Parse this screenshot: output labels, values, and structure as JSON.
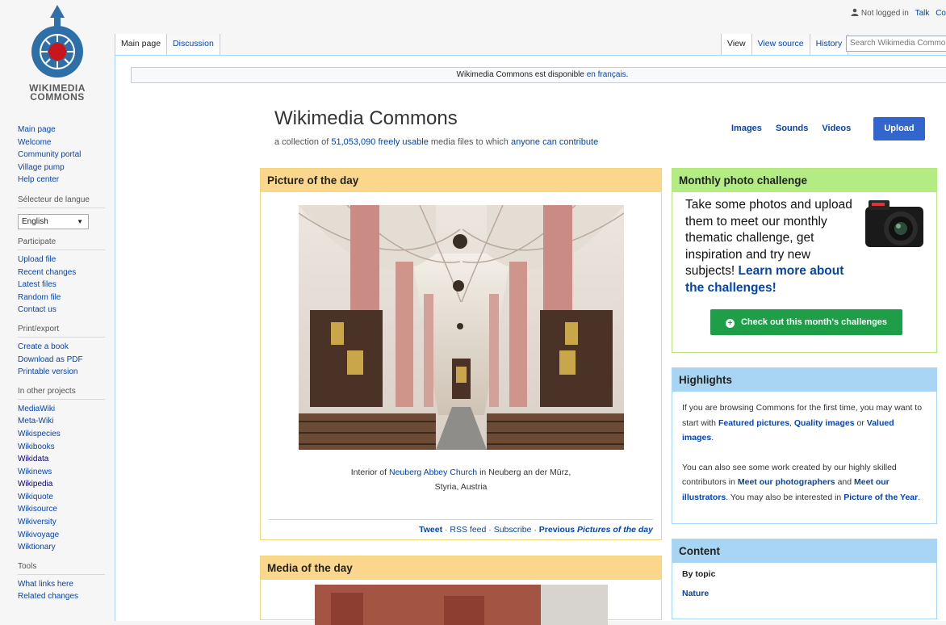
{
  "logo": {
    "line1": "WIKIMEDIA",
    "line2": "COMMONS"
  },
  "user_links": {
    "not_logged_in": "Not logged in",
    "talk": "Talk",
    "contributions": "Co"
  },
  "tabs": {
    "main_page": "Main page",
    "discussion": "Discussion",
    "view": "View",
    "view_source": "View source",
    "history": "History"
  },
  "search": {
    "placeholder": "Search Wikimedia Commons"
  },
  "sidebar": {
    "navigation": [
      "Main page",
      "Welcome",
      "Community portal",
      "Village pump",
      "Help center"
    ],
    "language_heading": "Sélecteur de langue",
    "language_selected": "English",
    "participate_heading": "Participate",
    "participate": [
      "Upload file",
      "Recent changes",
      "Latest files",
      "Random file",
      "Contact us"
    ],
    "print_heading": "Print/export",
    "print": [
      "Create a book",
      "Download as PDF",
      "Printable version"
    ],
    "projects_heading": "In other projects",
    "projects": [
      "MediaWiki",
      "Meta-Wiki",
      "Wikispecies",
      "Wikibooks",
      "Wikidata",
      "Wikinews",
      "Wikipedia",
      "Wikiquote",
      "Wikisource",
      "Wikiversity",
      "Wikivoyage",
      "Wiktionary"
    ],
    "tools_heading": "Tools",
    "tools": [
      "What links here",
      "Related changes"
    ]
  },
  "notice": {
    "text": "Wikimedia Commons est disponible",
    "link": "en français",
    "end": "."
  },
  "page": {
    "title": "Wikimedia Commons",
    "tagline_prefix": "a collection of",
    "file_count": "51,053,090",
    "freely_usable": "freely usable",
    "tagline_middle": "media files to which",
    "anyone_can_contribute": "anyone can contribute"
  },
  "media_links": [
    "Images",
    "Sounds",
    "Videos"
  ],
  "upload_button": "Upload",
  "potd": {
    "heading": "Picture of the day",
    "caption_prefix": "Interior of",
    "caption_link": "Neuberg Abbey Church",
    "caption_suffix": "in Neuberg an der Mürz,",
    "caption_line2": "Styria, Austria",
    "footer": {
      "tweet": "Tweet",
      "sep": " · ",
      "rss": "RSS feed",
      "subscribe": "Subscribe",
      "previous": "Previous",
      "potd": "Pictures of the day"
    }
  },
  "motd": {
    "heading": "Media of the day"
  },
  "challenge": {
    "heading": "Monthly photo challenge",
    "text": "Take some photos and upload them to meet our monthly thematic challenge, get inspiration and try new subjects!",
    "learn_more": "Learn more about the challenges!",
    "button": "Check out this month's challenges"
  },
  "highlights": {
    "heading": "Highlights",
    "p1_a": "If you are browsing Commons for the first time, you may want to start with",
    "featured": "Featured pictures",
    "comma": ",",
    "quality": "Quality images",
    "or": "or",
    "valued": "Valued images",
    "period": ".",
    "p2_a": "You can also see some work created by our highly skilled contributors in",
    "photographers": "Meet our photographers",
    "and": "and",
    "illustrators": "Meet our illustrators",
    "p2_b": ". You may also be interested in",
    "poty": "Picture of the Year"
  },
  "content_box": {
    "heading": "Content",
    "by_topic": "By topic",
    "nature": "Nature"
  },
  "colors": {
    "link": "#0645ad",
    "upload": "#3366cc",
    "challenge_button": "#1e9e47",
    "potd_header": "#fbd78d",
    "challenge_header": "#b4ec84",
    "highlights_header": "#a9d5f5"
  }
}
